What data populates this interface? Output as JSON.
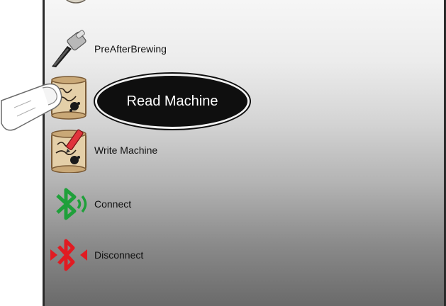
{
  "menu": {
    "items": [
      {
        "label": "PreAfterBrewing",
        "icon": "portafilter-icon"
      },
      {
        "label": "",
        "icon": "scroll-read-icon"
      },
      {
        "label": "Write Machine",
        "icon": "scroll-write-icon"
      },
      {
        "label": "Connect",
        "icon": "bluetooth-connect-icon"
      },
      {
        "label": "Disconnect",
        "icon": "bluetooth-disconnect-icon"
      }
    ]
  },
  "callout": {
    "label": "Read Machine"
  },
  "colors": {
    "bluetooth_connect": "#1fa03a",
    "bluetooth_disconnect": "#e11b22",
    "callout_bg": "#0f0f0f"
  }
}
